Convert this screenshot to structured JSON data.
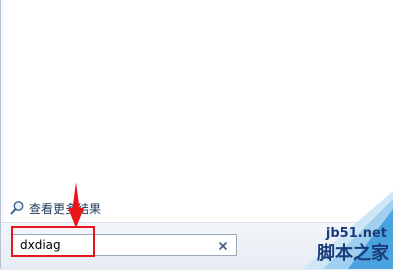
{
  "see_more": {
    "label": "查看更多结果",
    "icon": "magnifier-icon"
  },
  "search": {
    "value": "dxdiag",
    "clear_icon": "close-x-icon"
  },
  "annotation": {
    "color": "#e8151a"
  },
  "watermark": {
    "domain": "jb51.net",
    "name": "脚本之家",
    "color": "#1a3c7a",
    "accent": "#4aa3e0"
  }
}
